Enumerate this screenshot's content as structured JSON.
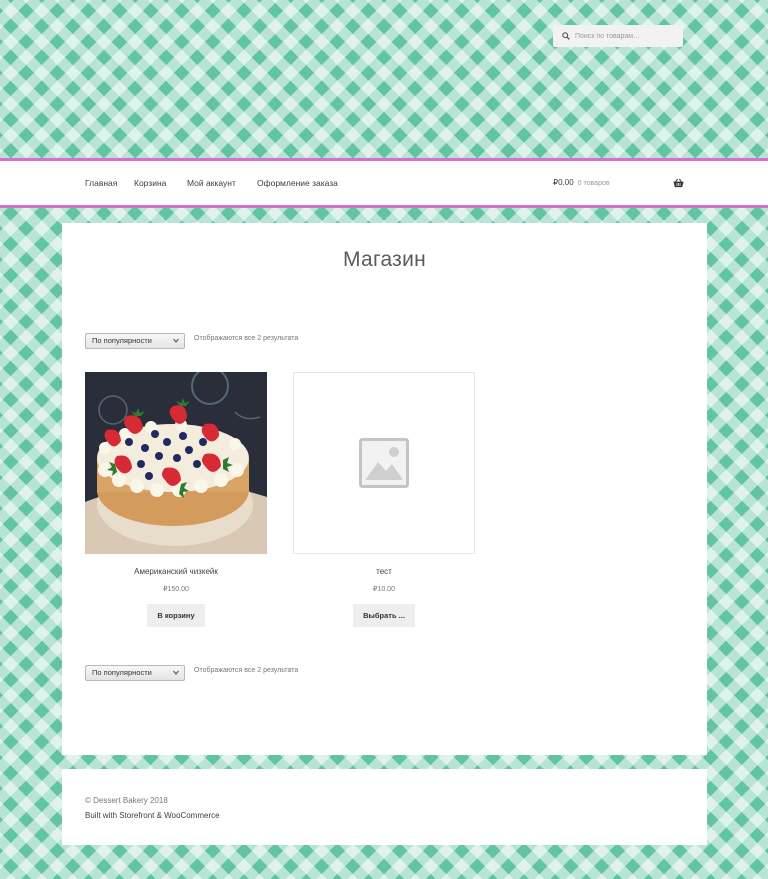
{
  "header": {
    "search": {
      "placeholder": "Поиск по товарам…",
      "icon": "search-icon"
    }
  },
  "nav": {
    "items": [
      {
        "label": "Главная"
      },
      {
        "label": "Корзина"
      },
      {
        "label": "Мой аккаунт"
      },
      {
        "label": "Оформление заказа"
      }
    ],
    "cart": {
      "amount": "₽0.00",
      "count": "0 товаров",
      "icon": "basket-icon"
    }
  },
  "main": {
    "title": "Магазин",
    "sort_top": {
      "selected": "По популярности",
      "result_count": "Отображаются все 2 результата"
    },
    "sort_bottom": {
      "selected": "По популярности",
      "result_count": "Отображаются все 2 результата"
    },
    "products": [
      {
        "name": "Американский чизкейк",
        "price": "₽150.00",
        "button": "В корзину",
        "image": "cheesecake-with-strawberries"
      },
      {
        "name": "тест",
        "price": "₽10.00",
        "button": "Выбрать ...",
        "image": "placeholder-image-icon"
      }
    ]
  },
  "footer": {
    "copyright": "© Dessert Bakery 2018",
    "built_with": "Built with Storefront & WooCommerce"
  },
  "colors": {
    "background": "#62c4a5",
    "nav_border": "#d86fcb",
    "panel": "#ffffff"
  }
}
